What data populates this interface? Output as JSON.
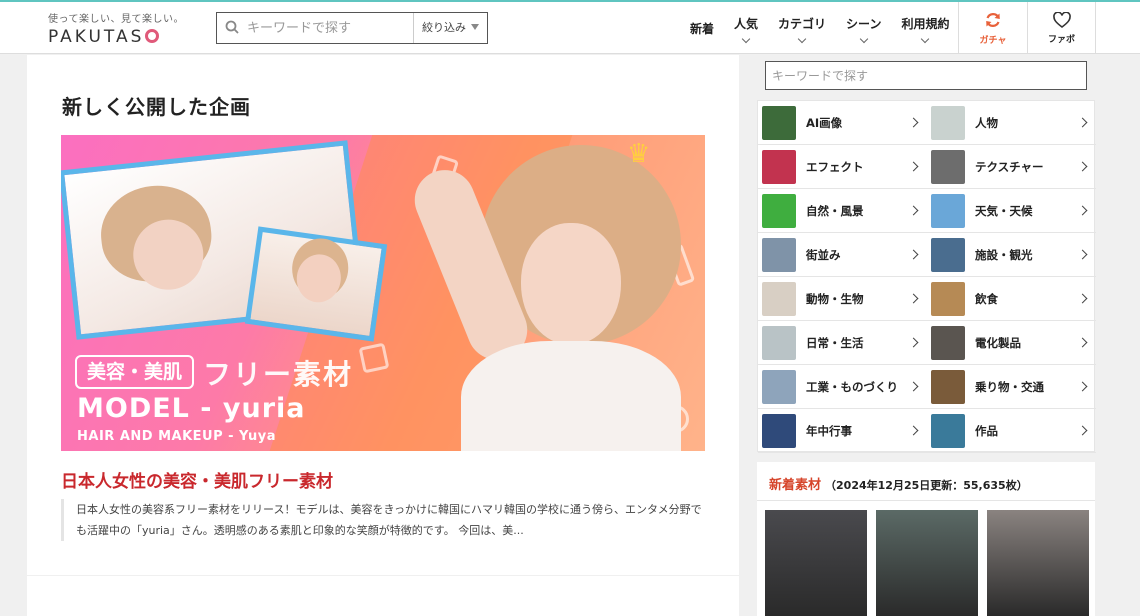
{
  "header": {
    "logo_tagline": "使って楽しい、見て楽しい。",
    "logo_text": "PAKUTAS",
    "search_placeholder": "キーワードで探す",
    "filter_label": "絞り込み",
    "nav": [
      {
        "label": "新着",
        "chevron": false
      },
      {
        "label": "人気",
        "chevron": true
      },
      {
        "label": "カテゴリ",
        "chevron": true
      },
      {
        "label": "シーン",
        "chevron": true
      },
      {
        "label": "利用規約",
        "chevron": true
      }
    ],
    "gacha_label": "ガチャ",
    "fav_label": "ファボ"
  },
  "main": {
    "section_title": "新しく公開した企画",
    "banner": {
      "tag": "美容・美肌",
      "tag2": "フリー素材",
      "model": "MODEL - yuria",
      "hair_credit": "HAIR AND MAKEUP - Yuya"
    },
    "post_title": "日本人女性の美容・美肌フリー素材",
    "post_excerpt": "日本人女性の美容系フリー素材をリリース！モデルは、美容をきっかけに韓国にハマリ韓国の学校に通う傍ら、エンタメ分野でも活躍中の「yuria」さん。透明感のある素肌と印象的な笑顔が特徴的です。 今回は、美..."
  },
  "sidebar": {
    "search_placeholder": "キーワードで探す",
    "categories": [
      {
        "label": "AI画像",
        "color": "#3d6b3a"
      },
      {
        "label": "人物",
        "color": "#c9d2cf"
      },
      {
        "label": "エフェクト",
        "color": "#c2334f"
      },
      {
        "label": "テクスチャー",
        "color": "#6d6d6d"
      },
      {
        "label": "自然・風景",
        "color": "#3fae3f"
      },
      {
        "label": "天気・天候",
        "color": "#6aa7d8"
      },
      {
        "label": "街並み",
        "color": "#7f93a8"
      },
      {
        "label": "施設・観光",
        "color": "#4a6d8f"
      },
      {
        "label": "動物・生物",
        "color": "#d8cfc4"
      },
      {
        "label": "飲食",
        "color": "#b68a55"
      },
      {
        "label": "日常・生活",
        "color": "#b9c3c6"
      },
      {
        "label": "電化製品",
        "color": "#5a5550"
      },
      {
        "label": "工業・ものづくり",
        "color": "#8ea4bb"
      },
      {
        "label": "乗り物・交通",
        "color": "#7a5b3a"
      },
      {
        "label": "年中行事",
        "color": "#2f4a7a"
      },
      {
        "label": "作品",
        "color": "#3a7a9a"
      }
    ],
    "new_title": "新着素材",
    "new_sub": "（2024年12月25日更新：55,635枚）",
    "new_thumbs": [
      {
        "color": "#4a4a4e"
      },
      {
        "color": "#5b6a66"
      },
      {
        "color": "#8a8380"
      }
    ]
  }
}
